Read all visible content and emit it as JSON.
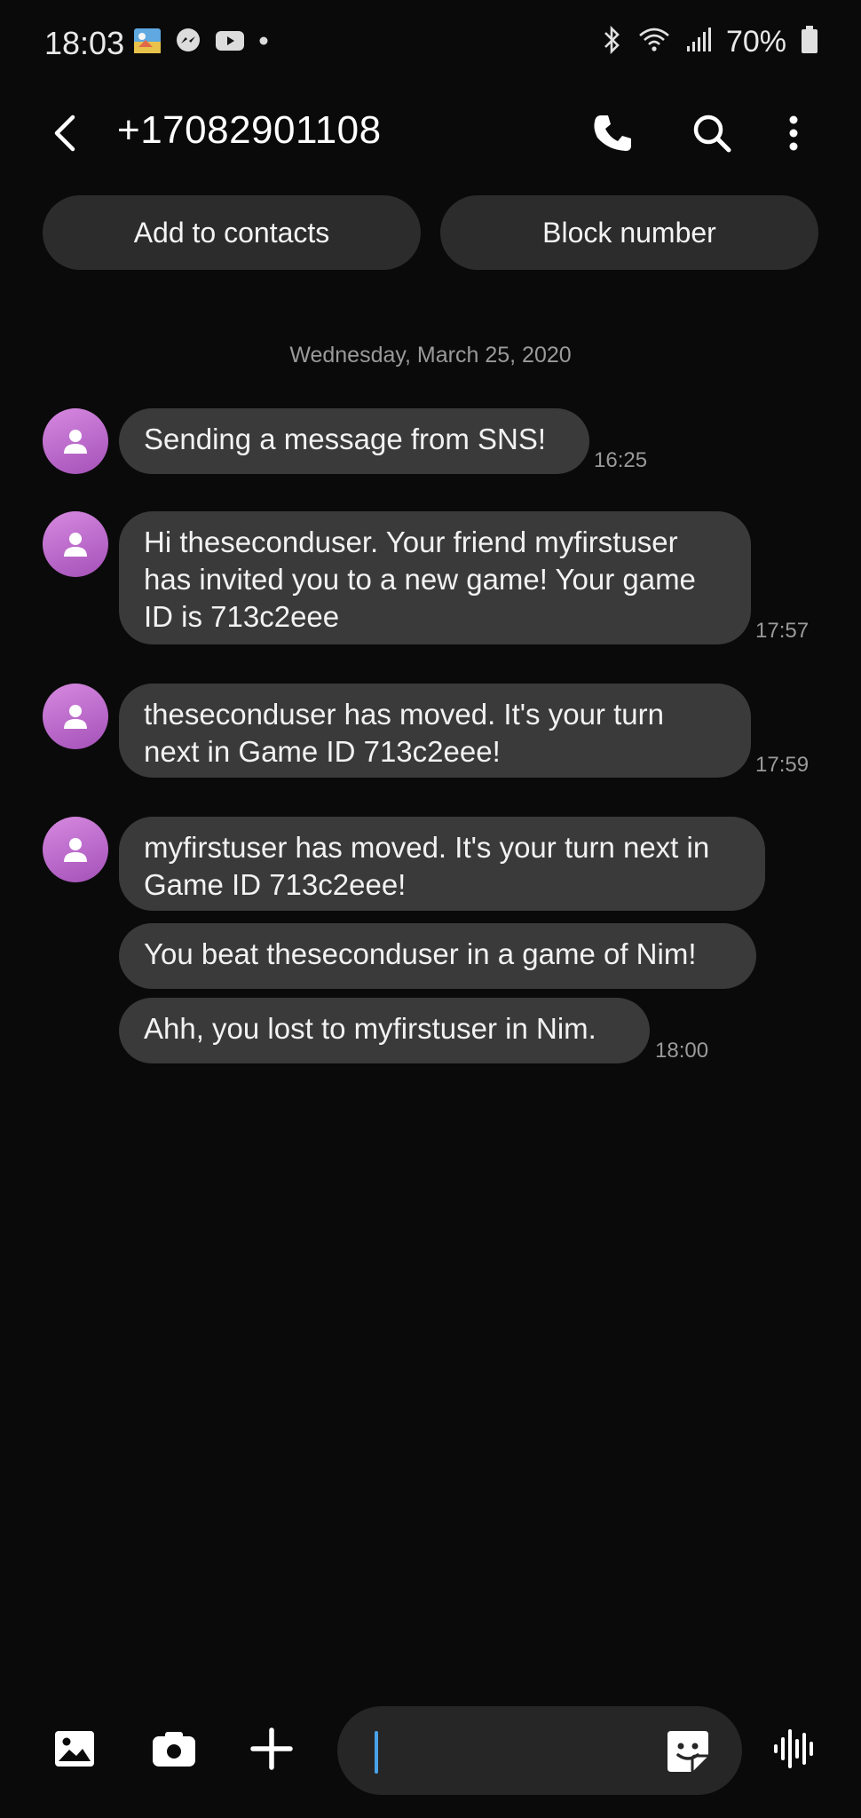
{
  "status_bar": {
    "time": "18:03",
    "battery_text": "70%",
    "left_icons": [
      "gallery-app-icon",
      "messenger-icon",
      "youtube-icon",
      "dot-icon"
    ],
    "right_icons": [
      "bluetooth-icon",
      "wifi-icon",
      "signal-icon",
      "battery-icon"
    ]
  },
  "header": {
    "title": "+17082901108",
    "actions": [
      "phone-icon",
      "search-icon",
      "more-vert-icon"
    ]
  },
  "actions": {
    "add_contacts": "Add to contacts",
    "block_number": "Block number"
  },
  "conversation": {
    "date": "Wednesday, March 25, 2020",
    "messages": [
      {
        "text": "Sending a message from SNS!",
        "time": "16:25"
      },
      {
        "text": "Hi theseconduser. Your friend myfirstuser has invited you to a new game! Your game ID is 713c2eee",
        "time": "17:57"
      },
      {
        "text": "theseconduser has moved. It's your turn next in Game ID 713c2eee!",
        "time": "17:59"
      },
      {
        "text": "myfirstuser has moved. It's your turn next in Game ID 713c2eee!",
        "time": ""
      },
      {
        "text": "You beat theseconduser in a game of Nim!",
        "time": ""
      },
      {
        "text": "Ahh, you lost to myfirstuser in Nim.",
        "time": "18:00"
      }
    ]
  },
  "composer": {
    "value": "",
    "buttons": [
      "image-icon",
      "camera-icon",
      "plus-icon",
      "sticker-icon",
      "voice-icon"
    ]
  },
  "colors": {
    "background": "#0a0a0a",
    "bubble": "#3a3a3a",
    "pill": "#2c2c2c",
    "avatar": "#b566c9",
    "cursor": "#4aa3e8"
  }
}
